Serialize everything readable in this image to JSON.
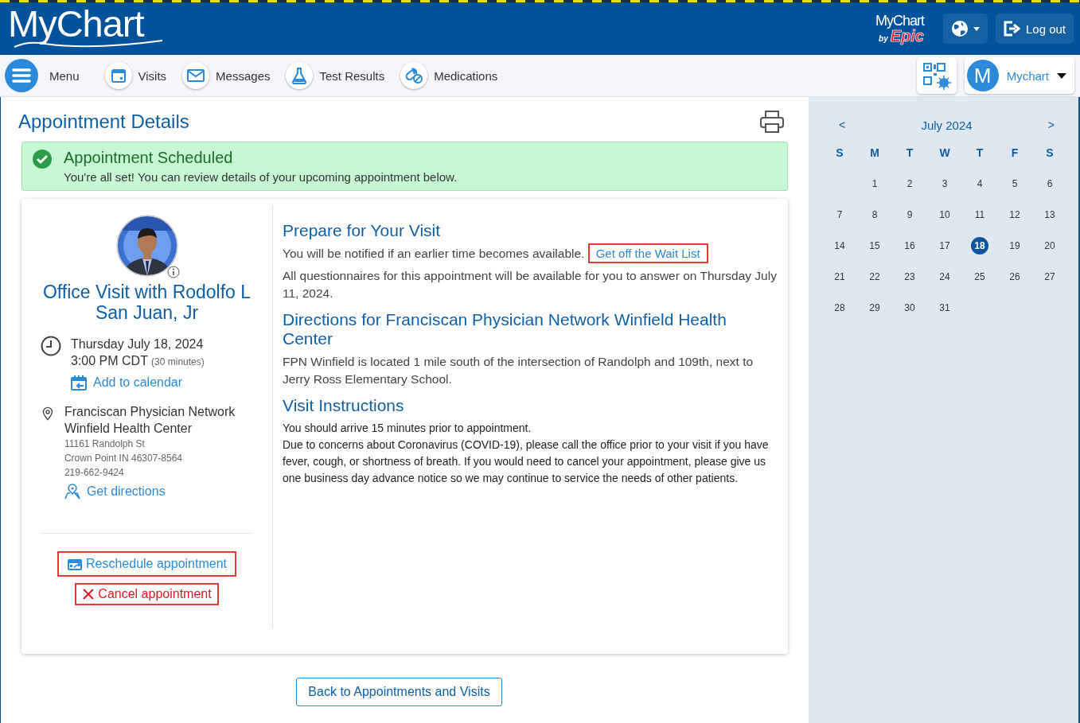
{
  "header": {
    "logo": "MyChart",
    "brand_top": "MyChart",
    "brand_by": "by",
    "brand_epic": "Epic",
    "logout": "Log out"
  },
  "nav": {
    "menu": "Menu",
    "items": [
      {
        "label": "Visits",
        "kind": "calendar"
      },
      {
        "label": "Messages",
        "kind": "mail"
      },
      {
        "label": "Test Results",
        "kind": "flask"
      },
      {
        "label": "Medications",
        "kind": "pills"
      }
    ],
    "account": {
      "initial": "M",
      "name": "Mychart"
    }
  },
  "page": {
    "title": "Appointment Details"
  },
  "banner": {
    "title": "Appointment Scheduled",
    "message": "You're all set! You can review details of your upcoming appointment below."
  },
  "visit": {
    "title": "Office Visit with Rodolfo L San Juan, Jr",
    "date": "Thursday July 18, 2024",
    "time": "3:00 PM CDT",
    "duration": "(30 minutes)",
    "add_calendar": "Add to calendar",
    "location_name": "Franciscan Physician Network Winfield Health Center",
    "address": [
      "11161 Randolph St",
      "Crown Point IN 46307-8564",
      "219-662-9424"
    ],
    "directions": "Get directions",
    "actions": [
      {
        "label": "Reschedule appointment",
        "kind": "reschedule",
        "highlighted": true
      },
      {
        "label": "Cancel appointment",
        "kind": "cancel",
        "highlighted": true
      }
    ]
  },
  "sections": [
    {
      "heading": "Prepare for Your Visit",
      "kind": "prose",
      "paragraphs": [
        {
          "text": "You will be notified if an earlier time becomes available.",
          "link": {
            "label": "Get off the Wait List",
            "highlighted": true
          }
        },
        {
          "text": "All questionnaires for this appointment will be available for you to answer on Thursday July 11, 2024."
        }
      ]
    },
    {
      "heading": "Directions for Franciscan Physician Network Winfield Health Center",
      "kind": "prose",
      "paragraphs": [
        {
          "text": "FPN Winfield is located 1 mile south of the intersection of Randolph and 109th,  next to Jerry Ross Elementary School."
        }
      ]
    },
    {
      "heading": "Visit Instructions",
      "kind": "plain",
      "paragraphs": [
        {
          "text": "You should arrive 15 minutes prior to appointment."
        },
        {
          "text": "Due to concerns about Coronavirus (COVID-19), please call the office prior to your visit if you have fever, cough, or shortness of breath.  If you would need to cancel your appointment, please give us one business day advance notice so we may continue to service the needs of other patients."
        }
      ]
    }
  ],
  "back_button": "Back to Appointments and Visits",
  "calendar": {
    "month": "July 2024",
    "prev": "<",
    "next": ">",
    "weekdays": [
      "S",
      "M",
      "T",
      "W",
      "T",
      "F",
      "S"
    ],
    "weeks": [
      {
        "days": [
          {
            "label": "1",
            "selected": false
          },
          {
            "label": "2",
            "selected": false
          },
          {
            "label": "3",
            "selected": false
          },
          {
            "label": "4",
            "selected": false
          },
          {
            "label": "5",
            "selected": false
          },
          {
            "label": "6",
            "selected": false
          }
        ]
      },
      {
        "days": [
          {
            "label": "7",
            "selected": false
          },
          {
            "label": "8",
            "selected": false
          },
          {
            "label": "9",
            "selected": false
          },
          {
            "label": "10",
            "selected": false
          },
          {
            "label": "11",
            "selected": false
          },
          {
            "label": "12",
            "selected": false
          },
          {
            "label": "13",
            "selected": false
          }
        ]
      },
      {
        "days": [
          {
            "label": "14",
            "selected": false
          },
          {
            "label": "15",
            "selected": false
          },
          {
            "label": "16",
            "selected": false
          },
          {
            "label": "17",
            "selected": false
          },
          {
            "label": "18",
            "selected": true
          },
          {
            "label": "19",
            "selected": false
          },
          {
            "label": "20",
            "selected": false
          }
        ]
      },
      {
        "days": [
          {
            "label": "21",
            "selected": false
          },
          {
            "label": "22",
            "selected": false
          },
          {
            "label": "23",
            "selected": false
          },
          {
            "label": "24",
            "selected": false
          },
          {
            "label": "25",
            "selected": false
          },
          {
            "label": "26",
            "selected": false
          },
          {
            "label": "27",
            "selected": false
          }
        ]
      },
      {
        "days": [
          {
            "label": "28",
            "selected": false
          },
          {
            "label": "29",
            "selected": false
          },
          {
            "label": "30",
            "selected": false
          },
          {
            "label": "31",
            "selected": false
          }
        ]
      }
    ]
  }
}
